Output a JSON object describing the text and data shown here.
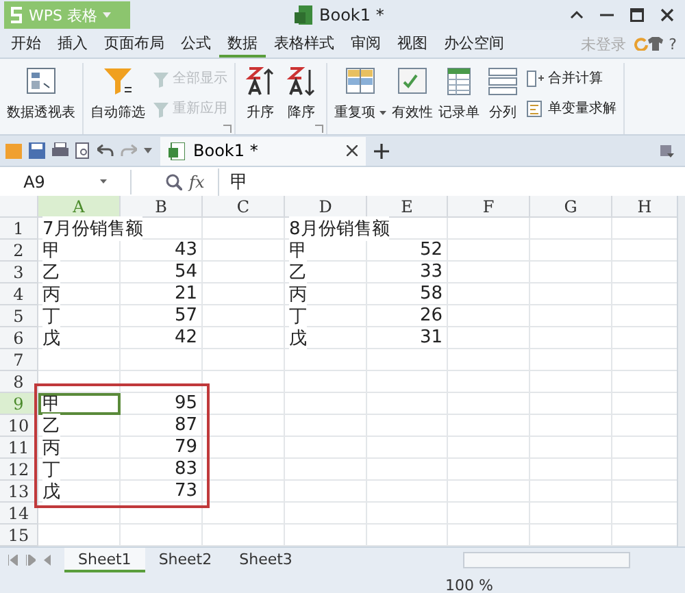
{
  "app_button": {
    "label": "WPS 表格"
  },
  "window": {
    "title": "Book1 *"
  },
  "menu_tabs": [
    {
      "label": "开始",
      "selected": false
    },
    {
      "label": "插入",
      "selected": false
    },
    {
      "label": "页面布局",
      "selected": false
    },
    {
      "label": "公式",
      "selected": false
    },
    {
      "label": "数据",
      "selected": true
    },
    {
      "label": "表格样式",
      "selected": false
    },
    {
      "label": "审阅",
      "selected": false
    },
    {
      "label": "视图",
      "selected": false
    },
    {
      "label": "办公空间",
      "selected": false
    }
  ],
  "account": {
    "label": "未登录"
  },
  "help": {
    "label": "?"
  },
  "ribbon_groups": [
    {
      "launcher": false,
      "items": [
        {
          "kind": "large",
          "label": "数据透视表",
          "disabled": false,
          "dropdown": false
        }
      ]
    },
    {
      "launcher": true,
      "items": [
        {
          "kind": "large",
          "label": "自动筛选",
          "disabled": false,
          "dropdown": false
        },
        {
          "kind": "small",
          "label": "全部显示",
          "disabled": true,
          "dropdown": false
        },
        {
          "kind": "small",
          "label": "重新应用",
          "disabled": true,
          "dropdown": false
        }
      ]
    },
    {
      "launcher": true,
      "items": [
        {
          "kind": "large",
          "label": "升序",
          "disabled": false,
          "dropdown": false
        },
        {
          "kind": "large",
          "label": "降序",
          "disabled": false,
          "dropdown": false
        }
      ]
    },
    {
      "launcher": false,
      "items": [
        {
          "kind": "large",
          "label": "重复项",
          "disabled": false,
          "dropdown": true
        },
        {
          "kind": "large",
          "label": "有效性",
          "disabled": false,
          "dropdown": false
        },
        {
          "kind": "large",
          "label": "记录单",
          "disabled": false,
          "dropdown": false
        },
        {
          "kind": "large",
          "label": "分列",
          "disabled": false,
          "dropdown": false
        },
        {
          "kind": "small",
          "label": "合并计算",
          "disabled": false,
          "dropdown": false
        },
        {
          "kind": "small",
          "label": "单变量求解",
          "disabled": false,
          "dropdown": false
        }
      ]
    }
  ],
  "doc_tabs": [
    {
      "label": "Book1 *",
      "selected": true
    }
  ],
  "formula_bar": {
    "name_box": "A9",
    "fx": "fx",
    "value": "甲"
  },
  "columns": [
    {
      "label": "A",
      "selected": true
    },
    {
      "label": "B",
      "selected": false
    },
    {
      "label": "C",
      "selected": false
    },
    {
      "label": "D",
      "selected": false
    },
    {
      "label": "E",
      "selected": false
    },
    {
      "label": "F",
      "selected": false
    },
    {
      "label": "G",
      "selected": false
    },
    {
      "label": "H",
      "selected": false
    }
  ],
  "rows": [
    {
      "label": "1",
      "selected": false,
      "framed": false,
      "cells": {
        "A": "7月份销售额",
        "D": "8月份销售额"
      }
    },
    {
      "label": "2",
      "selected": false,
      "framed": false,
      "cells": {
        "A": "甲",
        "B": "43",
        "D": "甲",
        "E": "52"
      }
    },
    {
      "label": "3",
      "selected": false,
      "framed": false,
      "cells": {
        "A": "乙",
        "B": "54",
        "D": "乙",
        "E": "33"
      }
    },
    {
      "label": "4",
      "selected": false,
      "framed": false,
      "cells": {
        "A": "丙",
        "B": "21",
        "D": "丙",
        "E": "58"
      }
    },
    {
      "label": "5",
      "selected": false,
      "framed": false,
      "cells": {
        "A": "丁",
        "B": "57",
        "D": "丁",
        "E": "26"
      }
    },
    {
      "label": "6",
      "selected": false,
      "framed": false,
      "cells": {
        "A": "戊",
        "B": "42",
        "D": "戊",
        "E": "31"
      }
    },
    {
      "label": "7",
      "selected": false,
      "framed": false,
      "cells": {}
    },
    {
      "label": "8",
      "selected": false,
      "framed": false,
      "cells": {}
    },
    {
      "label": "9",
      "selected": true,
      "framed": true,
      "cells": {
        "A": "甲",
        "B": "95"
      }
    },
    {
      "label": "10",
      "selected": false,
      "framed": true,
      "cells": {
        "A": "乙",
        "B": "87"
      }
    },
    {
      "label": "11",
      "selected": false,
      "framed": true,
      "cells": {
        "A": "丙",
        "B": "79"
      }
    },
    {
      "label": "12",
      "selected": false,
      "framed": true,
      "cells": {
        "A": "丁",
        "B": "83"
      }
    },
    {
      "label": "13",
      "selected": false,
      "framed": true,
      "cells": {
        "A": "戊",
        "B": "73"
      }
    },
    {
      "label": "14",
      "selected": false,
      "framed": false,
      "cells": {}
    },
    {
      "label": "15",
      "selected": false,
      "framed": false,
      "cells": {}
    }
  ],
  "sheet_tabs": [
    {
      "label": "Sheet1",
      "selected": true
    },
    {
      "label": "Sheet2",
      "selected": false
    },
    {
      "label": "Sheet3",
      "selected": false
    }
  ],
  "status_bar": {
    "zoom": "100 %"
  }
}
